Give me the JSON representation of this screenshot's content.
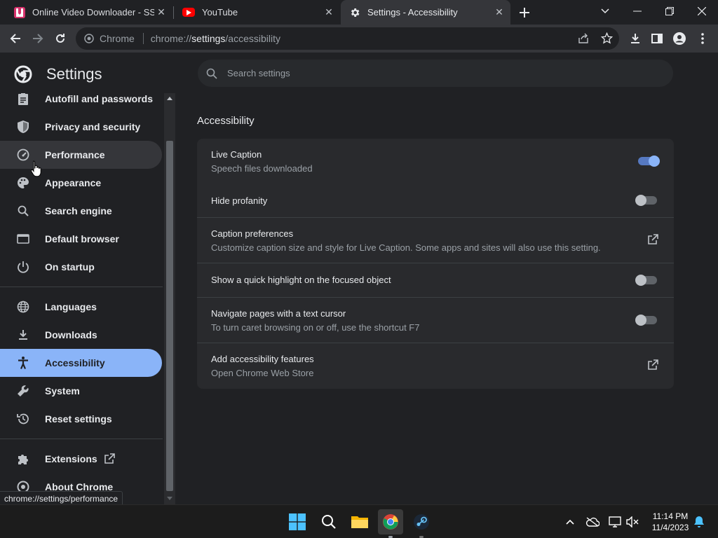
{
  "tabs": [
    {
      "title": "Online Video Downloader - SSYo",
      "favicon": "ssyoutube-icon",
      "active": false
    },
    {
      "title": "YouTube",
      "favicon": "youtube-icon",
      "active": false
    },
    {
      "title": "Settings - Accessibility",
      "favicon": "gear-icon",
      "active": true
    }
  ],
  "toolbar": {
    "site_chip": "Chrome",
    "url_scheme": "chrome://",
    "url_host": "settings",
    "url_path": "/accessibility"
  },
  "header": {
    "title": "Settings",
    "search_placeholder": "Search settings"
  },
  "sidebar": {
    "items": [
      {
        "label": "Autofill and passwords",
        "icon": "clipboard-icon"
      },
      {
        "label": "Privacy and security",
        "icon": "shield-icon"
      },
      {
        "label": "Performance",
        "icon": "speedometer-icon"
      },
      {
        "label": "Appearance",
        "icon": "palette-icon"
      },
      {
        "label": "Search engine",
        "icon": "search-icon"
      },
      {
        "label": "Default browser",
        "icon": "browser-window-icon"
      },
      {
        "label": "On startup",
        "icon": "power-icon"
      },
      {
        "label": "Languages",
        "icon": "globe-icon"
      },
      {
        "label": "Downloads",
        "icon": "download-icon"
      },
      {
        "label": "Accessibility",
        "icon": "accessibility-icon"
      },
      {
        "label": "System",
        "icon": "wrench-icon"
      },
      {
        "label": "Reset settings",
        "icon": "reset-icon"
      },
      {
        "label": "Extensions",
        "icon": "puzzle-icon"
      },
      {
        "label": "About Chrome",
        "icon": "chrome-icon"
      }
    ]
  },
  "main": {
    "section_title": "Accessibility",
    "rows": [
      {
        "title": "Live Caption",
        "subtitle": "Speech files downloaded",
        "control": "toggle",
        "on": true
      },
      {
        "title": "Hide profanity",
        "subtitle": "",
        "control": "toggle",
        "on": false
      },
      {
        "title": "Caption preferences",
        "subtitle": "Customize caption size and style for Live Caption. Some apps and sites will also use this setting.",
        "control": "external-link"
      },
      {
        "title": "Show a quick highlight on the focused object",
        "subtitle": "",
        "control": "toggle",
        "on": false
      },
      {
        "title": "Navigate pages with a text cursor",
        "subtitle": "To turn caret browsing on or off, use the shortcut F7",
        "control": "toggle",
        "on": false
      },
      {
        "title": "Add accessibility features",
        "subtitle": "Open Chrome Web Store",
        "control": "external-link"
      }
    ]
  },
  "status_bar": {
    "url": "chrome://settings/performance"
  },
  "taskbar": {
    "time": "11:14 PM",
    "date": "11/4/2023"
  },
  "colors": {
    "accent": "#8ab4f8",
    "background": "#202124",
    "card": "#292a2d"
  }
}
